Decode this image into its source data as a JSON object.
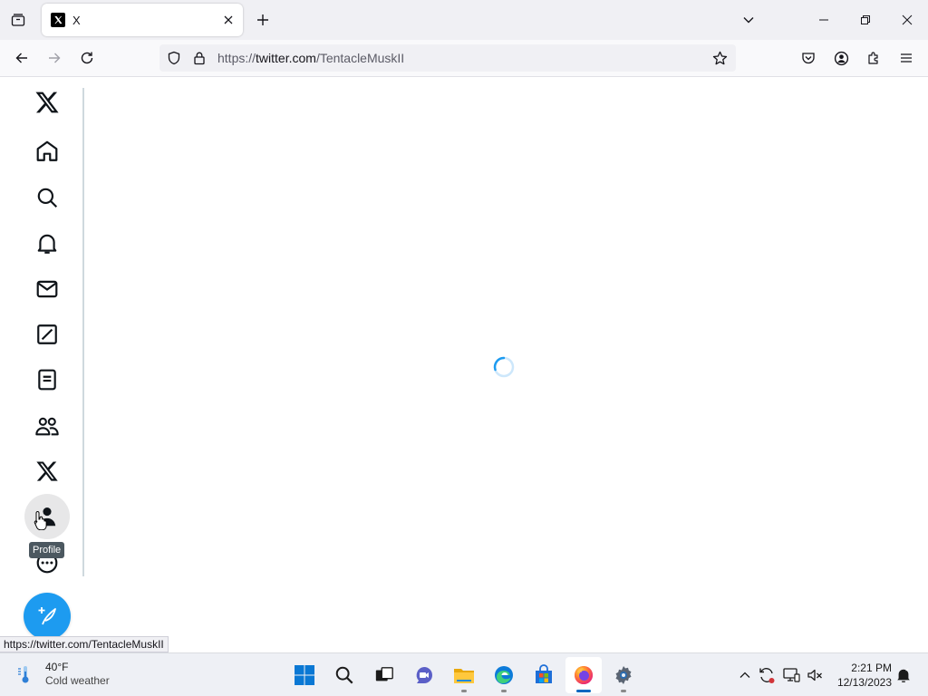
{
  "browser": {
    "tab": {
      "title": "X"
    },
    "url": {
      "scheme": "https://",
      "domain": "twitter.com",
      "path": "/TentacleMuskII"
    },
    "status_url": "https://twitter.com/TentacleMuskII",
    "icons": {
      "tab_list": "tab-list-icon",
      "close_tab": "close-icon",
      "new_tab": "plus-icon",
      "list_all_tabs": "chevron-down-icon",
      "back": "back-arrow-icon",
      "forward": "forward-arrow-icon",
      "reload": "reload-icon",
      "tracking_protection": "shield-icon",
      "connection": "lock-icon",
      "bookmark": "star-icon",
      "pocket": "pocket-icon",
      "account": "account-icon",
      "extensions": "puzzle-icon",
      "menu": "hamburger-icon"
    }
  },
  "sidebar": {
    "items": [
      {
        "id": "logo",
        "icon": "x-logo-icon"
      },
      {
        "id": "home",
        "icon": "home-icon"
      },
      {
        "id": "explore",
        "icon": "search-icon"
      },
      {
        "id": "notifications",
        "icon": "bell-icon"
      },
      {
        "id": "messages",
        "icon": "mail-icon"
      },
      {
        "id": "grok",
        "icon": "grok-icon"
      },
      {
        "id": "lists",
        "icon": "list-icon"
      },
      {
        "id": "communities",
        "icon": "communities-icon"
      },
      {
        "id": "premium",
        "icon": "x-logo-icon"
      },
      {
        "id": "profile",
        "icon": "person-icon"
      },
      {
        "id": "more",
        "icon": "more-circle-icon"
      }
    ],
    "tooltip": "Profile",
    "compose_icon": "feather-plus-icon"
  },
  "main": {
    "state": "loading",
    "spinner_icon": "spinner-icon"
  },
  "taskbar": {
    "weather": {
      "temp": "40°F",
      "description": "Cold weather"
    },
    "apps": [
      {
        "name": "start",
        "icon": "windows-logo-icon"
      },
      {
        "name": "search",
        "icon": "search-icon"
      },
      {
        "name": "task-view",
        "icon": "task-view-icon"
      },
      {
        "name": "teams-chat",
        "icon": "chat-icon"
      },
      {
        "name": "file-explorer",
        "icon": "folder-icon"
      },
      {
        "name": "edge",
        "icon": "edge-icon"
      },
      {
        "name": "store",
        "icon": "store-icon"
      },
      {
        "name": "firefox",
        "icon": "firefox-icon",
        "active": true
      },
      {
        "name": "settings",
        "icon": "gear-icon"
      }
    ],
    "tray": [
      {
        "name": "hidden-icons",
        "icon": "chevron-up-icon"
      },
      {
        "name": "sync",
        "icon": "sync-icon"
      },
      {
        "name": "network",
        "icon": "network-icon"
      },
      {
        "name": "volume",
        "icon": "speaker-muted-icon"
      }
    ],
    "clock": {
      "time": "2:21 PM",
      "date": "12/13/2023"
    },
    "notifications_icon": "notification-bell-icon"
  },
  "colors": {
    "accent": "#1d9bf0",
    "taskbar_active": "#0067c0",
    "divider": "#cfd9de"
  }
}
